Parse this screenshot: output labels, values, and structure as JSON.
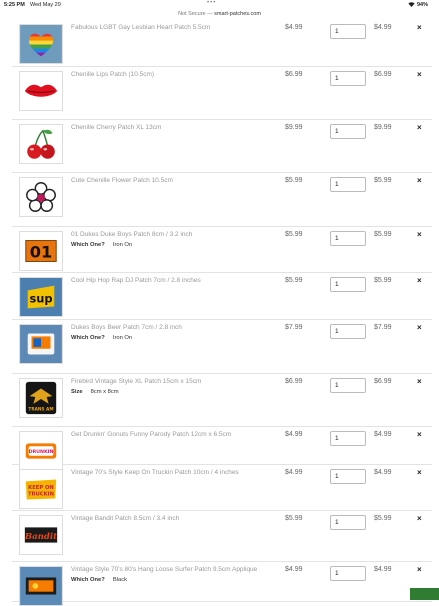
{
  "status": {
    "time": "5:25 PM",
    "date": "Wed May 29",
    "battery": "94%"
  },
  "browser": {
    "security": "Not Secure",
    "separator": "—",
    "domain": "smart-patches.com"
  },
  "items": [
    {
      "thumb": "rainbow-heart-patch",
      "title": "Fabulous LGBT Gay Lesbian Heart Patch 5.5cm",
      "price": "$4.99",
      "qty": "1",
      "total": "$4.99"
    },
    {
      "thumb": "lips-patch",
      "title": "Chenille Lips Patch (10.5cm)",
      "price": "$6.99",
      "qty": "1",
      "total": "$6.99"
    },
    {
      "thumb": "cherry-patch",
      "title": "Chenille Cherry Patch XL 13cm",
      "price": "$9.99",
      "qty": "1",
      "total": "$9.99"
    },
    {
      "thumb": "flower-patch",
      "title": "Cute Chenille Flower Patch 10.5cm",
      "price": "$5.99",
      "qty": "1",
      "total": "$5.99"
    },
    {
      "thumb": "dukes-01-patch",
      "title": "01 Dukes Duke Boys Patch 8cm / 3.2 inch",
      "option_label": "Which One?",
      "option_value": "Iron On",
      "price": "$5.99",
      "qty": "1",
      "total": "$5.99"
    },
    {
      "thumb": "sup-patch",
      "title": "Cool Hip Hop Rap DJ Patch 7cm / 2.8 inches",
      "price": "$5.99",
      "qty": "1",
      "total": "$5.99"
    },
    {
      "thumb": "dukes-beer-patch",
      "title": "Dukes Boys Beer Patch 7cm / 2.8 inch",
      "option_label": "Which One?",
      "option_value": "Iron On",
      "price": "$7.99",
      "qty": "1",
      "total": "$7.99"
    },
    {
      "thumb": "firebird-patch",
      "title": "Firebird Vintage Style XL Patch 15cm x 15cm",
      "option_label": "Size",
      "option_value": "8cm x 8cm",
      "price": "$6.99",
      "qty": "1",
      "total": "$6.99"
    },
    {
      "thumb": "drunkin-gonuts-patch",
      "title": "Get Drunkn' Gonuts Funny Parody Patch 12cm x 6.5cm",
      "price": "$4.99",
      "qty": "1",
      "total": "$4.99"
    },
    {
      "thumb": "keep-on-truckin-patch",
      "title": "Vintage 70's Style Keep On Truckin Patch 10cm / 4 inches",
      "price": "$4.99",
      "qty": "1",
      "total": "$4.99"
    },
    {
      "thumb": "bandit-patch",
      "title": "Vintage Bandit Patch 8.5cm / 3.4 inch",
      "price": "$5.99",
      "qty": "1",
      "total": "$5.99"
    },
    {
      "thumb": "surfer-patch",
      "title": "Vintage Style 70's 80's Hang Loose Surfer Patch 9.5cm Applique",
      "option_label": "Which One?",
      "option_value": "Black",
      "price": "$4.99",
      "qty": "1",
      "total": "$4.99"
    }
  ],
  "ui": {
    "remove_glyph": "×",
    "wifi_icon": "wifi-icon",
    "colors": {
      "row_border": "#e3e3e3",
      "title": "#9a9a9a",
      "price": "#666666"
    }
  }
}
